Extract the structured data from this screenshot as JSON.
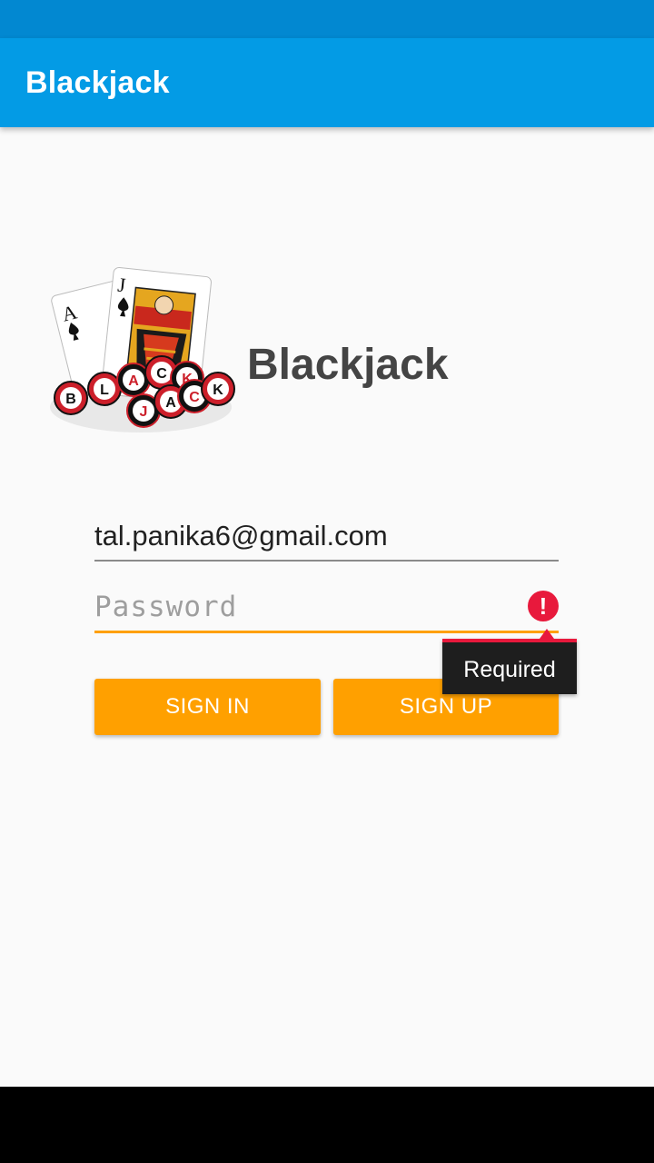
{
  "app_bar": {
    "title": "Blackjack"
  },
  "brand": {
    "title": "Blackjack"
  },
  "login_form": {
    "email_value": "tal.panika6@gmail.com",
    "password_placeholder": "Password",
    "password_error": "Required",
    "sign_in_label": "SIGN IN",
    "sign_up_label": "SIGN UP"
  },
  "logo": {
    "card_ace": "A",
    "card_jack": "J",
    "chips_top": [
      "B",
      "L",
      "A",
      "C",
      "K"
    ],
    "chips_bottom": [
      "J",
      "A",
      "C",
      "K"
    ]
  },
  "colors": {
    "status_bar": "#0288d1",
    "app_bar": "#039be5",
    "accent": "#ffa000",
    "error": "#e8193c"
  },
  "icons": {
    "error": "error-circle-icon"
  }
}
